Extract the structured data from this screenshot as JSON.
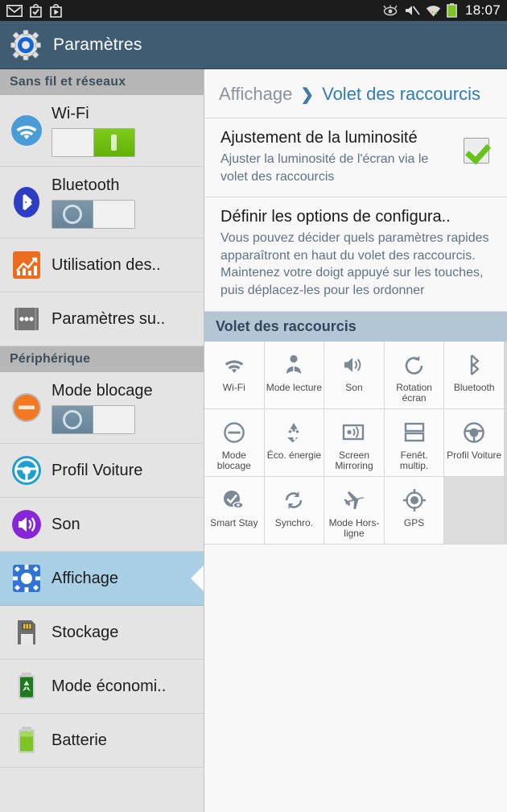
{
  "statusbar": {
    "icons_left": [
      "gmail-icon",
      "app-install-check-icon",
      "play-store-icon"
    ],
    "icons_right": [
      "smart-stay-eye-icon",
      "volume-muted-icon",
      "wifi-signal-icon",
      "battery-icon"
    ],
    "time": "18:07"
  },
  "appbar": {
    "title": "Paramètres",
    "icon": "settings-gear-icon"
  },
  "sidebar": {
    "sections": [
      {
        "header": "Sans fil et réseaux",
        "items": [
          {
            "label": "Wi-Fi",
            "icon": "wifi-icon",
            "toggle": "on"
          },
          {
            "label": "Bluetooth",
            "icon": "bluetooth-icon",
            "toggle": "off"
          },
          {
            "label": "Utilisation des..",
            "icon": "data-usage-icon"
          },
          {
            "label": "Paramètres su..",
            "icon": "more-settings-icon"
          }
        ]
      },
      {
        "header": "Périphérique",
        "items": [
          {
            "label": "Mode blocage",
            "icon": "blocking-mode-icon",
            "toggle": "off"
          },
          {
            "label": "Profil Voiture",
            "icon": "car-mode-icon"
          },
          {
            "label": "Son",
            "icon": "sound-icon"
          },
          {
            "label": "Affichage",
            "icon": "display-icon",
            "selected": true
          },
          {
            "label": "Stockage",
            "icon": "storage-icon"
          },
          {
            "label": "Mode économi..",
            "icon": "power-saving-icon"
          },
          {
            "label": "Batterie",
            "icon": "battery-settings-icon"
          }
        ]
      }
    ]
  },
  "panel": {
    "breadcrumb": {
      "parent": "Affichage",
      "separator": "❯",
      "current": "Volet des raccourcis"
    },
    "brightness": {
      "title": "Ajustement de la luminosité",
      "description": "Ajuster la luminosité de l'écran via le volet des raccourcis",
      "checked": true
    },
    "configure": {
      "title": "Définir les options de configura..",
      "description": "Vous pouvez décider quels paramètres rapides apparaîtront en haut du volet des raccourcis. Maintenez votre doigt appuyé sur les touches, puis déplacez-les pour les ordonner"
    },
    "grid_header": "Volet des raccourcis",
    "grid": [
      {
        "label": "Wi-Fi",
        "icon": "wifi-icon"
      },
      {
        "label": "Mode lecture",
        "icon": "reading-mode-icon"
      },
      {
        "label": "Son",
        "icon": "sound-icon"
      },
      {
        "label": "Rotation écran",
        "icon": "screen-rotation-icon"
      },
      {
        "label": "Bluetooth",
        "icon": "bluetooth-icon"
      },
      {
        "label": "Mode blocage",
        "icon": "blocking-mode-icon"
      },
      {
        "label": "Éco. énergie",
        "icon": "power-saving-icon"
      },
      {
        "label": "Screen Mirroring",
        "icon": "screen-mirroring-icon"
      },
      {
        "label": "Fenêt. multip.",
        "icon": "multi-window-icon"
      },
      {
        "label": "Profil Voiture",
        "icon": "car-mode-icon"
      },
      {
        "label": "Smart Stay",
        "icon": "smart-stay-icon"
      },
      {
        "label": "Synchro.",
        "icon": "sync-icon"
      },
      {
        "label": "Mode Hors-ligne",
        "icon": "airplane-mode-icon"
      },
      {
        "label": "GPS",
        "icon": "gps-icon"
      },
      {
        "label": "",
        "icon": "empty-slot",
        "empty": true
      }
    ]
  },
  "colors": {
    "appbar": "#3f5c72",
    "selected_row": "#a9cfe5",
    "toggle_on": "#6fbb10",
    "accent_link": "#2e7cb5",
    "grid_header": "#b3c6d6",
    "checkbox_check": "#67c219"
  }
}
